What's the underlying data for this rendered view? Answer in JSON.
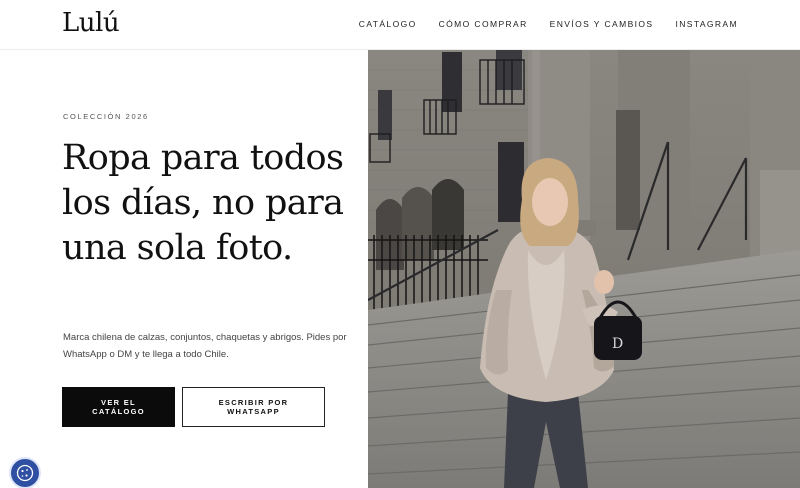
{
  "header": {
    "logo": "Lulú",
    "nav": [
      "CATÁLOGO",
      "CÓMO COMPRAR",
      "ENVÍOS Y CAMBIOS",
      "INSTAGRAM"
    ]
  },
  "hero": {
    "eyebrow": "COLECCIÓN 2026",
    "headline": "Ropa para todos los días, no para una sola foto.",
    "description": "Marca chilena de calzas, conjuntos, chaquetas y abrigos. Pides por WhatsApp o DM y te llega a todo Chile.",
    "primary_button": "VER EL CATÁLOGO",
    "secondary_button": "ESCRIBIR POR WHATSAPP"
  },
  "icons": {
    "cookie_settings": "cookie-icon"
  },
  "colors": {
    "primary_button_bg": "#0b0b0b",
    "cookie_button": "#2f4fa3",
    "bottom_strip": "#fbc7dd"
  }
}
